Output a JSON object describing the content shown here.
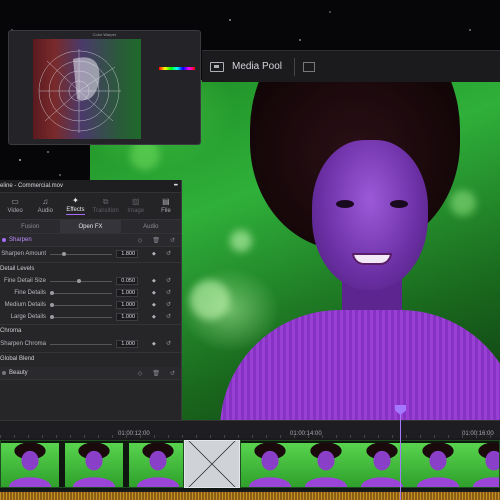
{
  "color_warper": {
    "title": "Color Warper"
  },
  "toolbar": {
    "media_pool_label": "Media Pool"
  },
  "inspector": {
    "title": "eline - Commercial.mov",
    "tabs": [
      {
        "icon": "▭",
        "label": "Video",
        "state": "normal"
      },
      {
        "icon": "♫",
        "label": "Audio",
        "state": "normal"
      },
      {
        "icon": "✦",
        "label": "Effects",
        "state": "active"
      },
      {
        "icon": "⧉",
        "label": "Transition",
        "state": "dim"
      },
      {
        "icon": "▨",
        "label": "Image",
        "state": "dim"
      },
      {
        "icon": "▤",
        "label": "File",
        "state": "normal"
      }
    ],
    "subtabs": [
      {
        "label": "Fusion",
        "state": "normal"
      },
      {
        "label": "Open FX",
        "state": "active"
      },
      {
        "label": "Audio",
        "state": "normal"
      }
    ],
    "sharpen": {
      "section_label": "Sharpen",
      "amount": {
        "label": "Sharpen Amount",
        "value": "1.800"
      },
      "detail_levels_label": "Detail Levels",
      "details": [
        {
          "label": "Fine Detail Size",
          "value": "0.050"
        },
        {
          "label": "Fine Details",
          "value": "1.000"
        },
        {
          "label": "Medium Details",
          "value": "1.000"
        },
        {
          "label": "Large Details",
          "value": "1.000"
        }
      ],
      "chroma_label": "Chroma",
      "chroma": {
        "label": "Sharpen Chroma",
        "value": "1.000"
      },
      "global_blend_label": "Global Blend"
    },
    "beauty": {
      "section_label": "Beauty"
    }
  },
  "timeline": {
    "timecodes": [
      "01:00:12:00",
      "01:00:14:00",
      "01:00:16:00"
    ]
  },
  "colors": {
    "accent": "#a477ff",
    "panel": "#262629",
    "background_green": "#2fb03a"
  }
}
